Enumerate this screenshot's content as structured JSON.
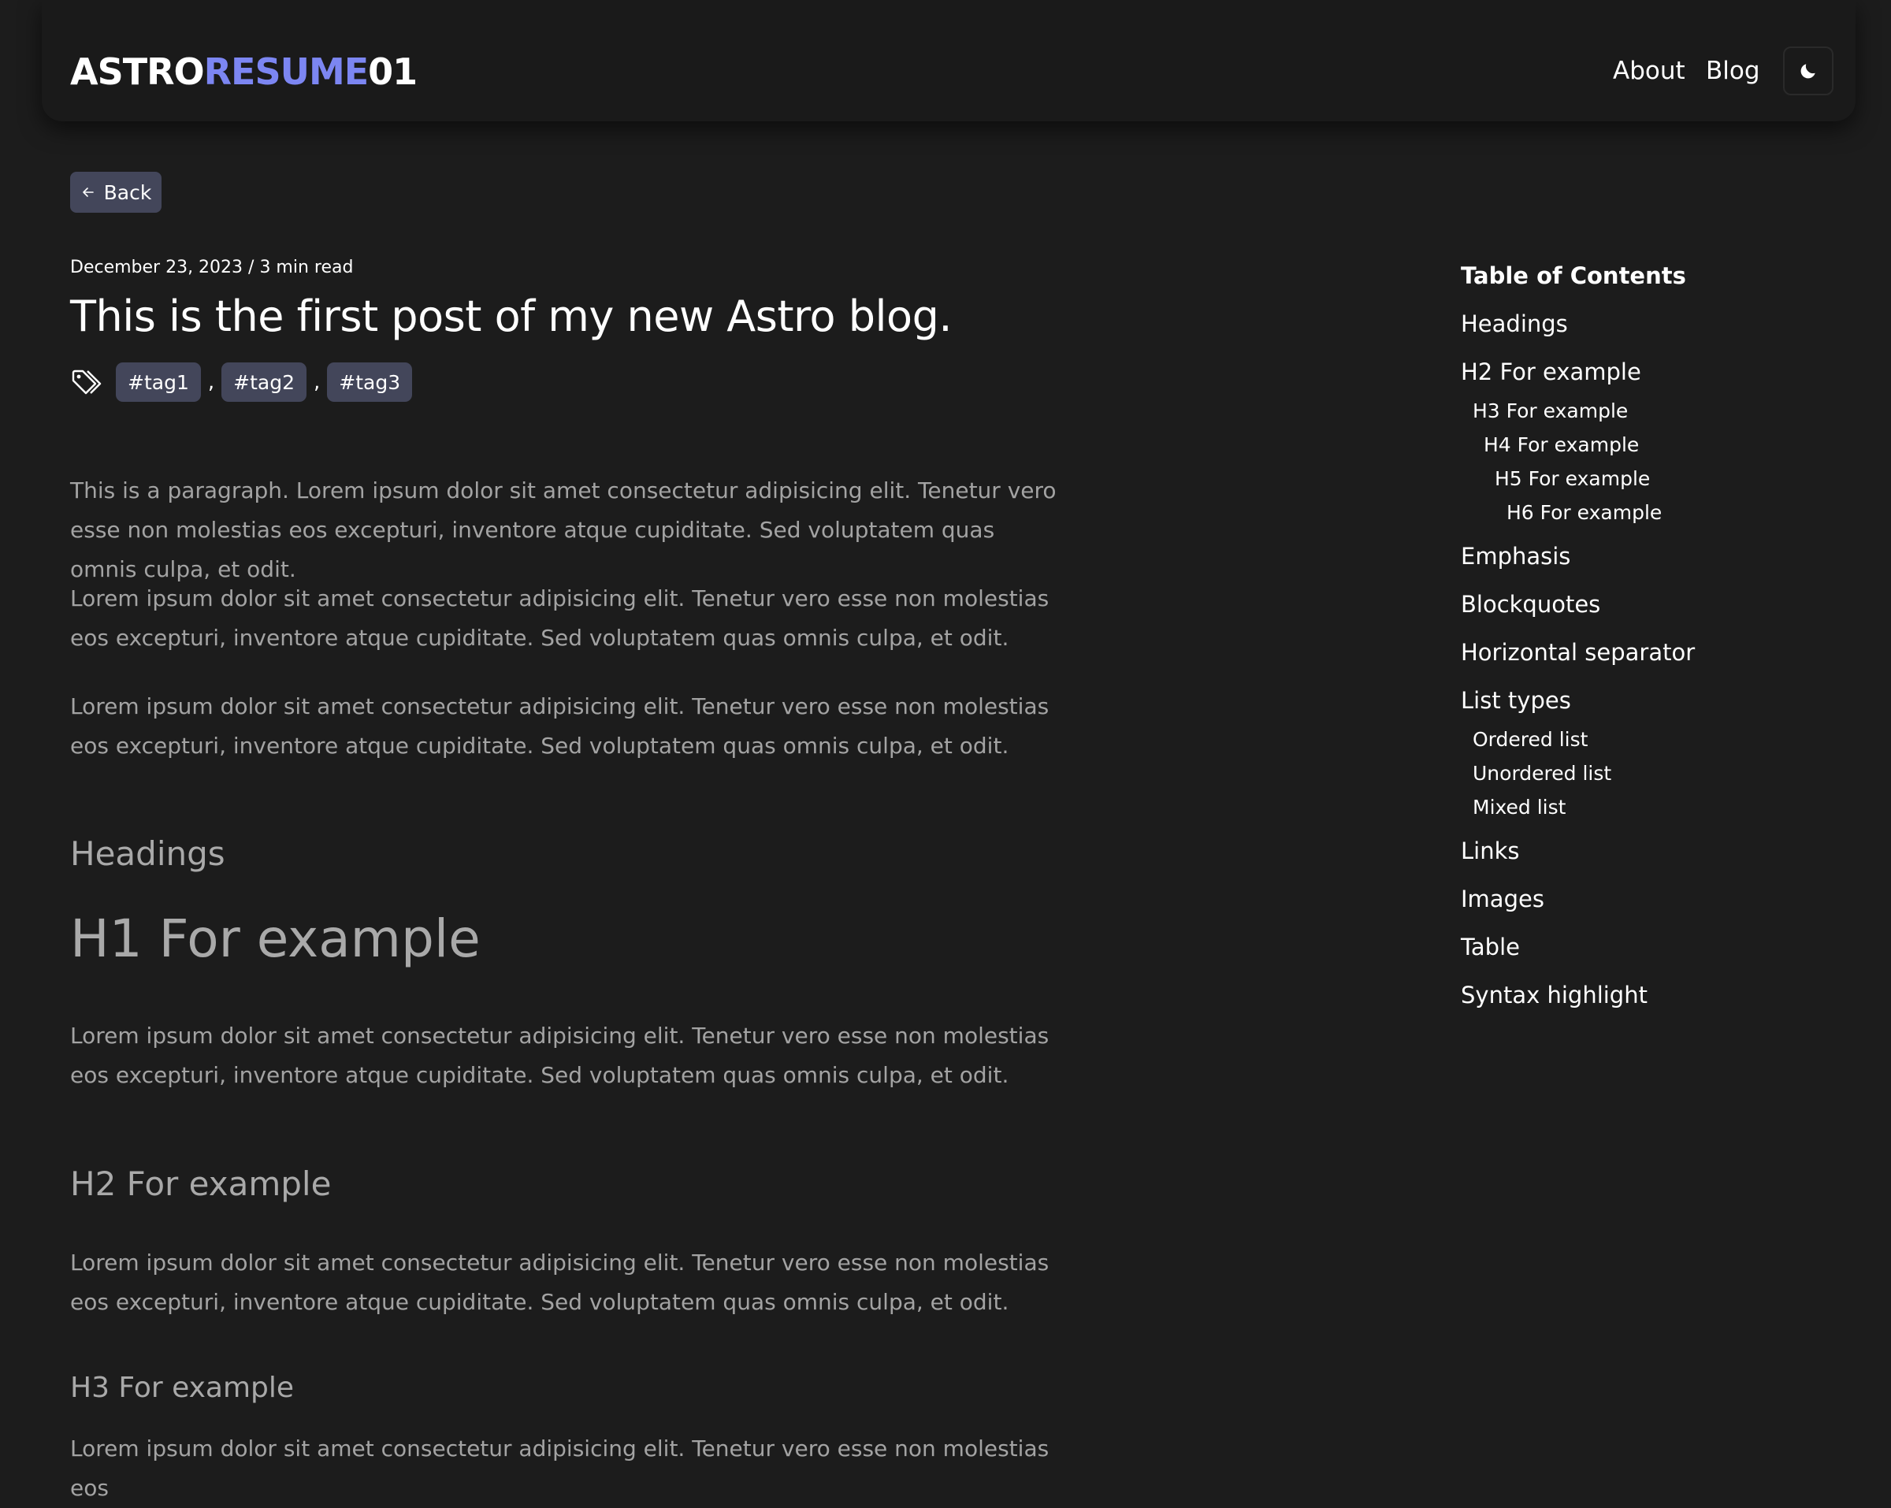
{
  "header": {
    "logo_part1": "ASTRO",
    "logo_part2": "RESUME",
    "logo_part3": "01",
    "nav_about": "About",
    "nav_blog": "Blog",
    "theme_icon": "moon-icon"
  },
  "back": {
    "label": "Back",
    "icon": "arrow-left-icon"
  },
  "post": {
    "meta": "December 23, 2023 / 3 min read",
    "title": "This is the first post of my new Astro blog.",
    "tag_icon": "tags-icon",
    "tags": [
      "#tag1",
      "#tag2",
      "#tag3"
    ],
    "comma": ","
  },
  "content": {
    "intro": "This is a paragraph. Lorem ipsum dolor sit amet consectetur adipisicing elit. Tenetur vero esse non molestias eos excepturi, inventore atque cupiditate. Sed voluptatem quas omnis culpa, et odit.",
    "lorem": "Lorem ipsum dolor sit amet consectetur adipisicing elit. Tenetur vero esse non molestias eos excepturi, inventore atque cupiditate. Sed voluptatem quas omnis culpa, et odit.",
    "lorem_partial": "Lorem ipsum dolor sit amet consectetur adipisicing elit. Tenetur vero esse non molestias eos",
    "headings_title": "Headings",
    "h1": "H1 For example",
    "h2": "H2 For example",
    "h3": "H3 For example"
  },
  "toc": {
    "title": "Table of Contents",
    "items": [
      "Headings",
      "H2 For example",
      "H3 For example",
      "H4 For example",
      "H5 For example",
      "H6 For example",
      "Emphasis",
      "Blockquotes",
      "Horizontal separator",
      "List types",
      "Ordered list",
      "Unordered list",
      "Mixed list",
      "Links",
      "Images",
      "Table",
      "Syntax highlight"
    ]
  },
  "colors": {
    "background": "#1c1c1c",
    "accent": "#7c86f2",
    "tag_bg": "#43465a",
    "muted_text": "#a3a3a3"
  }
}
